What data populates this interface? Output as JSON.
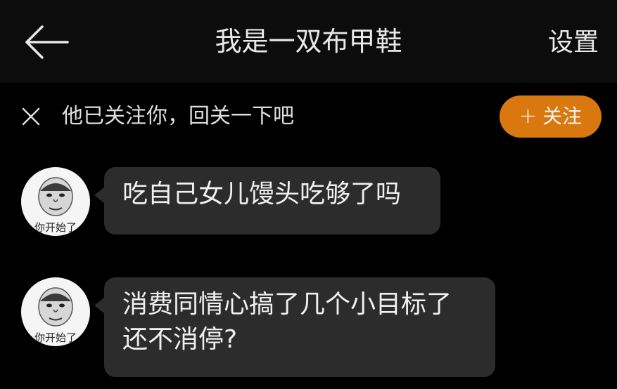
{
  "header": {
    "back_icon": "arrow-left-icon",
    "title": "我是一双布甲鞋",
    "settings_label": "设置"
  },
  "follow_bar": {
    "close_icon": "close-icon",
    "prompt": "他已关注你，回关一下吧",
    "follow_button_plus": "+",
    "follow_button_label": "关注",
    "accent_color": "#d9780f"
  },
  "messages": [
    {
      "avatar_caption": "你开始了",
      "lines": [
        "吃自己女儿馒头吃够了吗"
      ]
    },
    {
      "avatar_caption": "你开始了",
      "lines": [
        "消费同情心搞了几个小目标了",
        "还不消停?"
      ]
    }
  ]
}
